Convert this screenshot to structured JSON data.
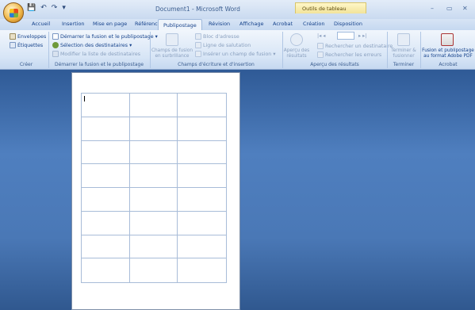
{
  "window": {
    "title": "Document1 - Microsoft Word",
    "context_tab": "Outils de tableau",
    "controls": [
      "–",
      "▭",
      "✕"
    ]
  },
  "quick_access": [
    "💾",
    "↶",
    "↷",
    "▾"
  ],
  "tabs": [
    {
      "label": "Accueil",
      "active": false
    },
    {
      "label": "Insertion",
      "active": false
    },
    {
      "label": "Mise en page",
      "active": false
    },
    {
      "label": "Références",
      "active": false
    },
    {
      "label": "Publipostage",
      "active": true
    },
    {
      "label": "Révision",
      "active": false
    },
    {
      "label": "Affichage",
      "active": false
    },
    {
      "label": "Acrobat",
      "active": false
    },
    {
      "label": "Création",
      "active": false
    },
    {
      "label": "Disposition",
      "active": false
    }
  ],
  "ribbon": {
    "creer": {
      "label": "Créer",
      "items": [
        "Enveloppes",
        "Étiquettes"
      ]
    },
    "demarrer": {
      "label": "Démarrer la fusion et le publipostage",
      "items": [
        "Démarrer la fusion et le publipostage",
        "Sélection des destinataires",
        "Modifier la liste de destinataires"
      ]
    },
    "champs": {
      "label": "Champs d'écriture et d'insertion",
      "big": "Champs de fusion en surbrillance",
      "items": [
        "Bloc d'adresse",
        "Ligne de salutation",
        "Insérer un champ de fusion"
      ]
    },
    "apercu": {
      "label": "Aperçu des résultats",
      "big": "Aperçu des résultats",
      "items": [
        "Rechercher un destinataire",
        "Rechercher les erreurs"
      ]
    },
    "terminer": {
      "label": "Terminer",
      "big": "Terminer & fusionner"
    },
    "acrobat": {
      "label": "Acrobat",
      "big": "Fusion et publipostage au format Adobe PDF"
    }
  },
  "colors": {
    "ribbon_text": "#15428b",
    "workspace": "#4f7fbf",
    "grid_lines": "#a8bcd8"
  }
}
